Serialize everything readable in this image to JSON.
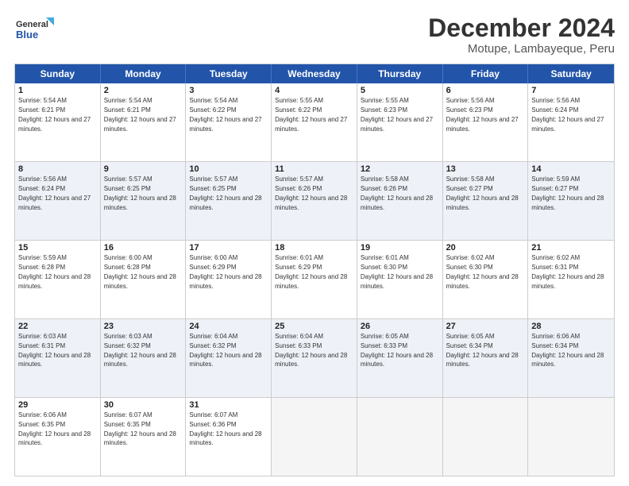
{
  "header": {
    "logo_line1": "General",
    "logo_line2": "Blue",
    "month": "December 2024",
    "location": "Motupe, Lambayeque, Peru"
  },
  "days": [
    "Sunday",
    "Monday",
    "Tuesday",
    "Wednesday",
    "Thursday",
    "Friday",
    "Saturday"
  ],
  "weeks": [
    [
      {
        "day": "1",
        "sunrise": "5:54 AM",
        "sunset": "6:21 PM",
        "daylight": "12 hours and 27 minutes."
      },
      {
        "day": "2",
        "sunrise": "5:54 AM",
        "sunset": "6:21 PM",
        "daylight": "12 hours and 27 minutes."
      },
      {
        "day": "3",
        "sunrise": "5:54 AM",
        "sunset": "6:22 PM",
        "daylight": "12 hours and 27 minutes."
      },
      {
        "day": "4",
        "sunrise": "5:55 AM",
        "sunset": "6:22 PM",
        "daylight": "12 hours and 27 minutes."
      },
      {
        "day": "5",
        "sunrise": "5:55 AM",
        "sunset": "6:23 PM",
        "daylight": "12 hours and 27 minutes."
      },
      {
        "day": "6",
        "sunrise": "5:56 AM",
        "sunset": "6:23 PM",
        "daylight": "12 hours and 27 minutes."
      },
      {
        "day": "7",
        "sunrise": "5:56 AM",
        "sunset": "6:24 PM",
        "daylight": "12 hours and 27 minutes."
      }
    ],
    [
      {
        "day": "8",
        "sunrise": "5:56 AM",
        "sunset": "6:24 PM",
        "daylight": "12 hours and 27 minutes."
      },
      {
        "day": "9",
        "sunrise": "5:57 AM",
        "sunset": "6:25 PM",
        "daylight": "12 hours and 28 minutes."
      },
      {
        "day": "10",
        "sunrise": "5:57 AM",
        "sunset": "6:25 PM",
        "daylight": "12 hours and 28 minutes."
      },
      {
        "day": "11",
        "sunrise": "5:57 AM",
        "sunset": "6:26 PM",
        "daylight": "12 hours and 28 minutes."
      },
      {
        "day": "12",
        "sunrise": "5:58 AM",
        "sunset": "6:26 PM",
        "daylight": "12 hours and 28 minutes."
      },
      {
        "day": "13",
        "sunrise": "5:58 AM",
        "sunset": "6:27 PM",
        "daylight": "12 hours and 28 minutes."
      },
      {
        "day": "14",
        "sunrise": "5:59 AM",
        "sunset": "6:27 PM",
        "daylight": "12 hours and 28 minutes."
      }
    ],
    [
      {
        "day": "15",
        "sunrise": "5:59 AM",
        "sunset": "6:28 PM",
        "daylight": "12 hours and 28 minutes."
      },
      {
        "day": "16",
        "sunrise": "6:00 AM",
        "sunset": "6:28 PM",
        "daylight": "12 hours and 28 minutes."
      },
      {
        "day": "17",
        "sunrise": "6:00 AM",
        "sunset": "6:29 PM",
        "daylight": "12 hours and 28 minutes."
      },
      {
        "day": "18",
        "sunrise": "6:01 AM",
        "sunset": "6:29 PM",
        "daylight": "12 hours and 28 minutes."
      },
      {
        "day": "19",
        "sunrise": "6:01 AM",
        "sunset": "6:30 PM",
        "daylight": "12 hours and 28 minutes."
      },
      {
        "day": "20",
        "sunrise": "6:02 AM",
        "sunset": "6:30 PM",
        "daylight": "12 hours and 28 minutes."
      },
      {
        "day": "21",
        "sunrise": "6:02 AM",
        "sunset": "6:31 PM",
        "daylight": "12 hours and 28 minutes."
      }
    ],
    [
      {
        "day": "22",
        "sunrise": "6:03 AM",
        "sunset": "6:31 PM",
        "daylight": "12 hours and 28 minutes."
      },
      {
        "day": "23",
        "sunrise": "6:03 AM",
        "sunset": "6:32 PM",
        "daylight": "12 hours and 28 minutes."
      },
      {
        "day": "24",
        "sunrise": "6:04 AM",
        "sunset": "6:32 PM",
        "daylight": "12 hours and 28 minutes."
      },
      {
        "day": "25",
        "sunrise": "6:04 AM",
        "sunset": "6:33 PM",
        "daylight": "12 hours and 28 minutes."
      },
      {
        "day": "26",
        "sunrise": "6:05 AM",
        "sunset": "6:33 PM",
        "daylight": "12 hours and 28 minutes."
      },
      {
        "day": "27",
        "sunrise": "6:05 AM",
        "sunset": "6:34 PM",
        "daylight": "12 hours and 28 minutes."
      },
      {
        "day": "28",
        "sunrise": "6:06 AM",
        "sunset": "6:34 PM",
        "daylight": "12 hours and 28 minutes."
      }
    ],
    [
      {
        "day": "29",
        "sunrise": "6:06 AM",
        "sunset": "6:35 PM",
        "daylight": "12 hours and 28 minutes."
      },
      {
        "day": "30",
        "sunrise": "6:07 AM",
        "sunset": "6:35 PM",
        "daylight": "12 hours and 28 minutes."
      },
      {
        "day": "31",
        "sunrise": "6:07 AM",
        "sunset": "6:36 PM",
        "daylight": "12 hours and 28 minutes."
      },
      null,
      null,
      null,
      null
    ]
  ]
}
